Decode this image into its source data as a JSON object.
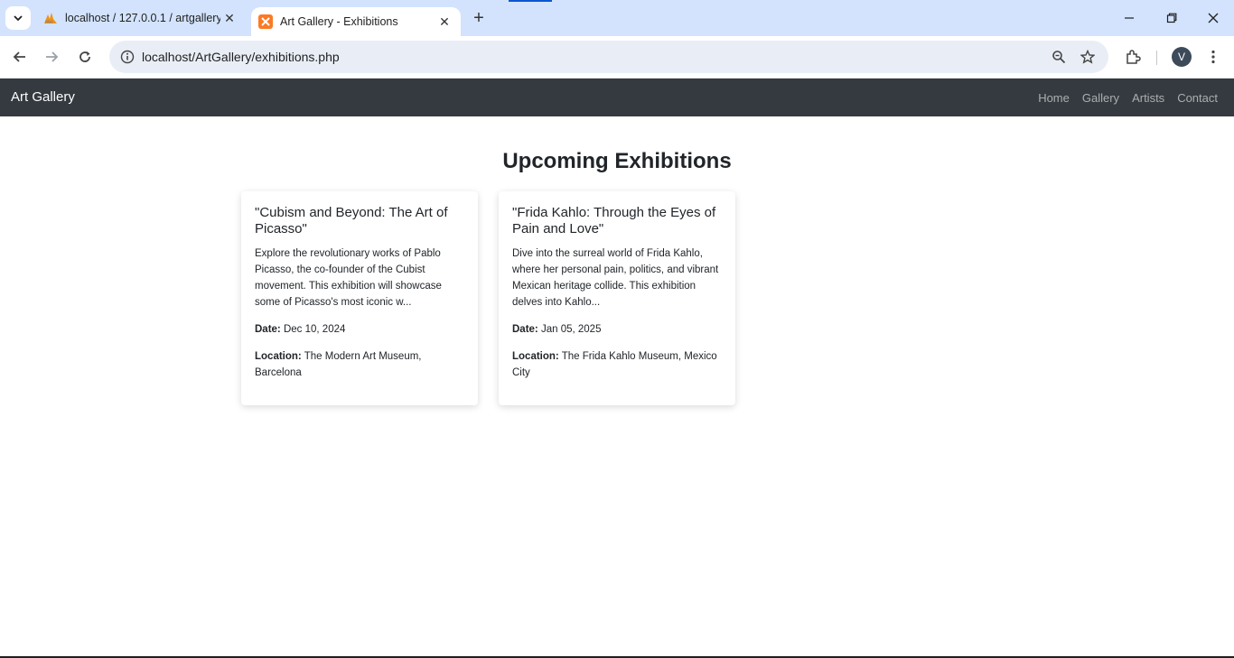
{
  "browser": {
    "tabs": [
      {
        "title": "localhost / 127.0.0.1 / artgallery",
        "close": "✕",
        "active": false
      },
      {
        "title": "Art Gallery - Exhibitions",
        "close": "✕",
        "active": true
      }
    ],
    "new_tab": "+",
    "url": "localhost/ArtGallery/exhibitions.php",
    "profile_initial": "V"
  },
  "site": {
    "brand": "Art Gallery",
    "nav": [
      "Home",
      "Gallery",
      "Artists",
      "Contact"
    ]
  },
  "main": {
    "heading": "Upcoming Exhibitions",
    "cards": [
      {
        "title": "\"Cubism and Beyond: The Art of Picasso\"",
        "description": "Explore the revolutionary works of Pablo Picasso, the co-founder of the Cubist movement. This exhibition will showcase some of Picasso's most iconic w...",
        "date_label": "Date:",
        "date": "Dec 10, 2024",
        "location_label": "Location:",
        "location": "The Modern Art Museum, Barcelona"
      },
      {
        "title": "\"Frida Kahlo: Through the Eyes of Pain and Love\"",
        "description": "Dive into the surreal world of Frida Kahlo, where her personal pain, politics, and vibrant Mexican heritage collide. This exhibition delves into Kahlo...",
        "date_label": "Date:",
        "date": "Jan 05, 2025",
        "location_label": "Location:",
        "location": "The Frida Kahlo Museum, Mexico City"
      }
    ]
  },
  "colors": {
    "tabstrip": "#d3e3fd",
    "navbar": "#343a40",
    "text": "#212529"
  }
}
